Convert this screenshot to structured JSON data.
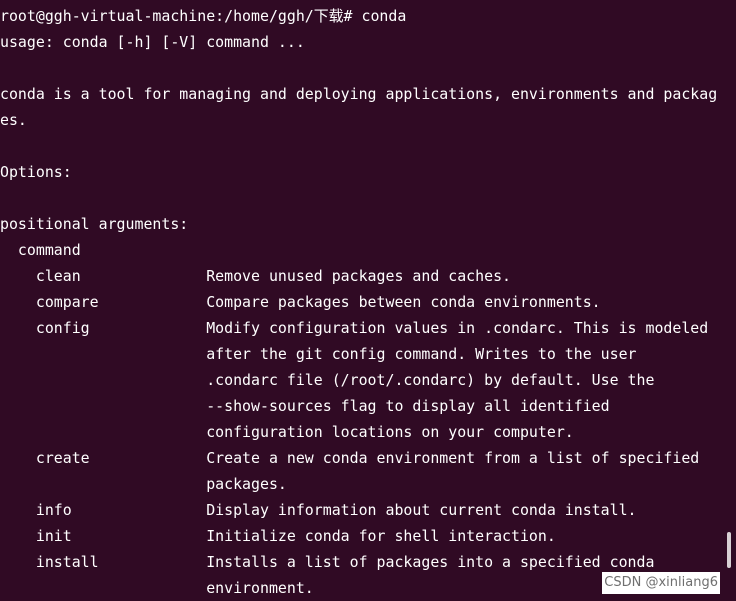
{
  "terminal": {
    "background_color": "#300a24",
    "text_color": "#ffffff",
    "lines": [
      "root@ggh-virtual-machine:/home/ggh/下载# conda",
      "usage: conda [-h] [-V] command ...",
      "",
      "conda is a tool for managing and deploying applications, environments and packag",
      "es.",
      "",
      "Options:",
      "",
      "positional arguments:",
      "  command",
      "    clean              Remove unused packages and caches.",
      "    compare            Compare packages between conda environments.",
      "    config             Modify configuration values in .condarc. This is modeled",
      "                       after the git config command. Writes to the user",
      "                       .condarc file (/root/.condarc) by default. Use the",
      "                       --show-sources flag to display all identified",
      "                       configuration locations on your computer.",
      "    create             Create a new conda environment from a list of specified",
      "                       packages.",
      "    info               Display information about current conda install.",
      "    init               Initialize conda for shell interaction.",
      "    install            Installs a list of packages into a specified conda",
      "                       environment."
    ]
  },
  "watermark": {
    "text": "CSDN @xinliang6"
  }
}
